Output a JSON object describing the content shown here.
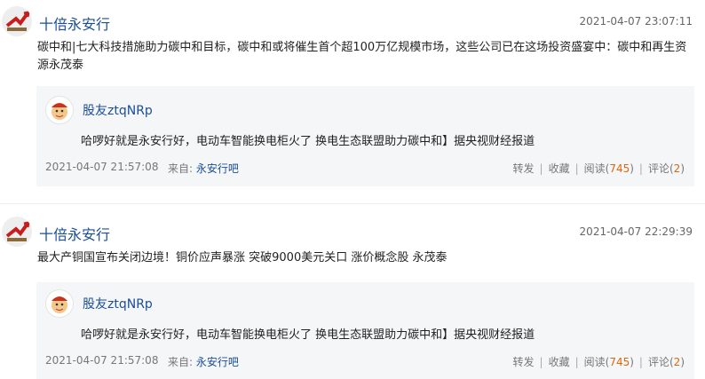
{
  "posts": [
    {
      "author": "十倍永安行",
      "time": "2021-04-07 23:07:11",
      "content": "碳中和|七大科技措施助力碳中和目标，碳中和或将催生首个超100万亿规模市场，这些公司已在这场投资盛宴中：碳中和再生资源永茂泰",
      "quote": {
        "author": "股友ztqNRp",
        "text": "哈啰好就是永安行好，电动车智能换电柜火了 换电生态联盟助力碳中和】据央视财经报道",
        "time": "2021-04-07 21:57:08",
        "from_label": "来自:",
        "from_source": "永安行吧",
        "forward": "转发",
        "collect": "收藏",
        "read_label": "阅读",
        "read_count": "745",
        "comment_label": "评论",
        "comment_count": "2"
      }
    },
    {
      "author": "十倍永安行",
      "time": "2021-04-07 22:29:39",
      "content": "最大产铜国宣布关闭边境！铜价应声暴涨 突破9000美元关口 涨价概念股 永茂泰",
      "quote": {
        "author": "股友ztqNRp",
        "text": "哈啰好就是永安行好，电动车智能换电柜火了 换电生态联盟助力碳中和】据央视财经报道",
        "time": "2021-04-07 21:57:08",
        "from_label": "来自:",
        "from_source": "永安行吧",
        "forward": "转发",
        "collect": "收藏",
        "read_label": "阅读",
        "read_count": "745",
        "comment_label": "评论",
        "comment_count": "2"
      }
    }
  ],
  "colors": {
    "link": "#1a4e99",
    "count": "#e8630a",
    "quote_bg": "#f5f6f8"
  }
}
